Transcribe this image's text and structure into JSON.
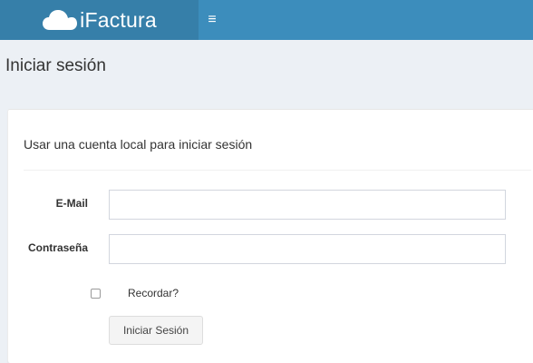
{
  "header": {
    "brand_name": "iFactura",
    "brand_icon": "cloud-icon",
    "menu_icon": "hamburger-menu-icon",
    "menu_glyph": "≡",
    "bar_color": "#3c8dbc",
    "brand_bg_color": "#367fa9"
  },
  "page": {
    "title": "Iniciar sesión"
  },
  "login_box": {
    "title": "Usar una cuenta local para iniciar sesión",
    "email_label": "E-Mail",
    "email_value": "",
    "password_label": "Contraseña",
    "password_value": "",
    "remember_label": "Recordar?",
    "remember_checked": false,
    "submit_label": "Iniciar Sesión"
  }
}
